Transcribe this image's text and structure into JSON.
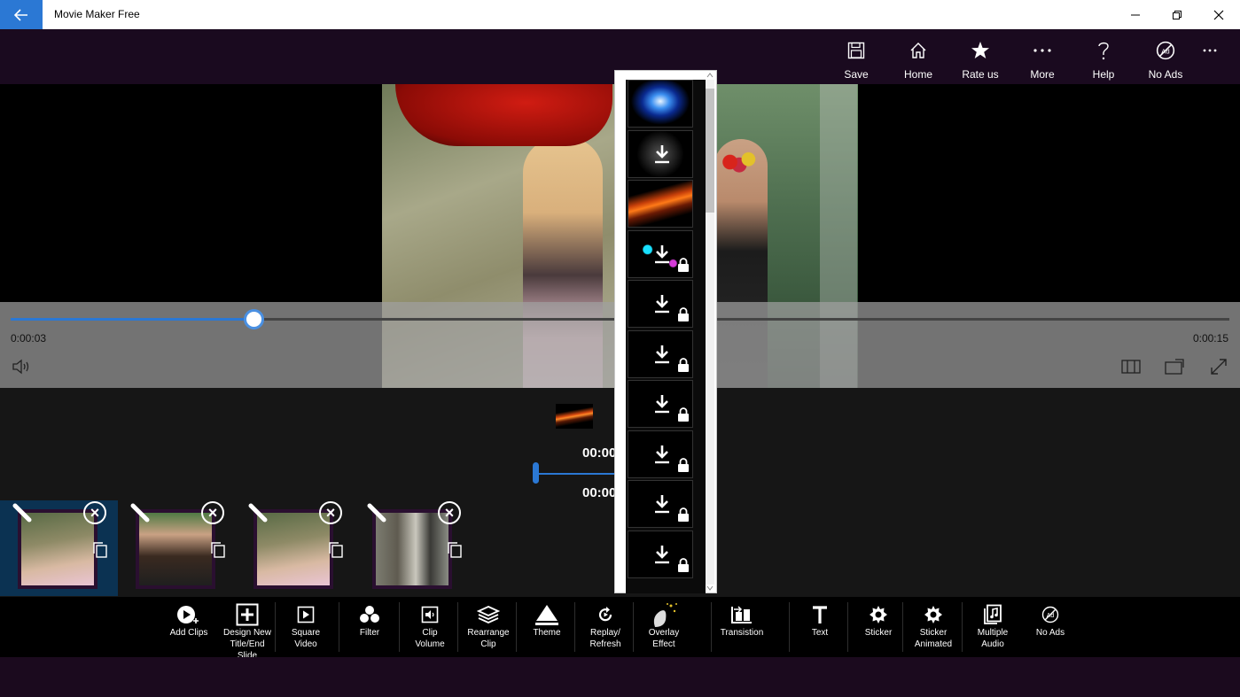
{
  "app": {
    "title": "Movie Maker Free"
  },
  "colors": {
    "accent": "#2b78d4",
    "title_bar": "#ffffff",
    "command_bar": "#1a0a1f",
    "toolbar": "#000000"
  },
  "command_bar": {
    "items": [
      {
        "label": "Save",
        "icon": "save-icon"
      },
      {
        "label": "Home",
        "icon": "home-icon"
      },
      {
        "label": "Rate us",
        "icon": "star-icon"
      },
      {
        "label": "More",
        "icon": "more-icon"
      },
      {
        "label": "Help",
        "icon": "help-icon"
      },
      {
        "label": "No Ads",
        "icon": "no-ads-icon"
      }
    ]
  },
  "player": {
    "current_time": "0:00:03",
    "end_time": "0:00:15",
    "progress": 0.2
  },
  "timeline": {
    "time_top": "00:00",
    "time_bottom": "00:00"
  },
  "clips": [
    {
      "selected": true
    },
    {
      "selected": false
    },
    {
      "selected": false
    },
    {
      "selected": false
    }
  ],
  "effects": {
    "items": [
      {
        "name": "blue-glow",
        "locked": false,
        "download": false
      },
      {
        "name": "white-sparkle",
        "locked": false,
        "download": true
      },
      {
        "name": "orange-streak",
        "locked": false,
        "download": false
      },
      {
        "name": "cyan-sparkle",
        "locked": true,
        "download": true
      },
      {
        "name": "effect-5",
        "locked": true,
        "download": true
      },
      {
        "name": "effect-6",
        "locked": true,
        "download": true
      },
      {
        "name": "effect-7",
        "locked": true,
        "download": true
      },
      {
        "name": "effect-8",
        "locked": true,
        "download": true
      },
      {
        "name": "effect-9",
        "locked": true,
        "download": true
      },
      {
        "name": "effect-10",
        "locked": true,
        "download": true
      }
    ]
  },
  "toolbar": {
    "items": [
      {
        "label": "Add Clips",
        "icon": "add-clips-icon"
      },
      {
        "label": "Design New\nTitle/End\nSlide",
        "icon": "design-slide-icon"
      },
      {
        "label": "Square\nVideo",
        "icon": "square-video-icon"
      },
      {
        "label": "Filter",
        "icon": "filter-icon"
      },
      {
        "label": "Clip\nVolume",
        "icon": "clip-volume-icon"
      },
      {
        "label": "Rearrange\nClip",
        "icon": "rearrange-icon"
      },
      {
        "label": "Theme",
        "icon": "theme-icon"
      },
      {
        "label": "Replay/\nRefresh",
        "icon": "replay-icon"
      },
      {
        "label": "Overlay\nEffect",
        "icon": "overlay-effect-icon"
      },
      {
        "label": "Transistion",
        "icon": "transition-icon"
      },
      {
        "label": "Text",
        "icon": "text-icon"
      },
      {
        "label": "Sticker",
        "icon": "sticker-icon"
      },
      {
        "label": "Sticker\nAnimated",
        "icon": "sticker-animated-icon"
      },
      {
        "label": "Multiple\nAudio",
        "icon": "multiple-audio-icon"
      },
      {
        "label": "No Ads",
        "icon": "no-ads-icon"
      }
    ]
  }
}
